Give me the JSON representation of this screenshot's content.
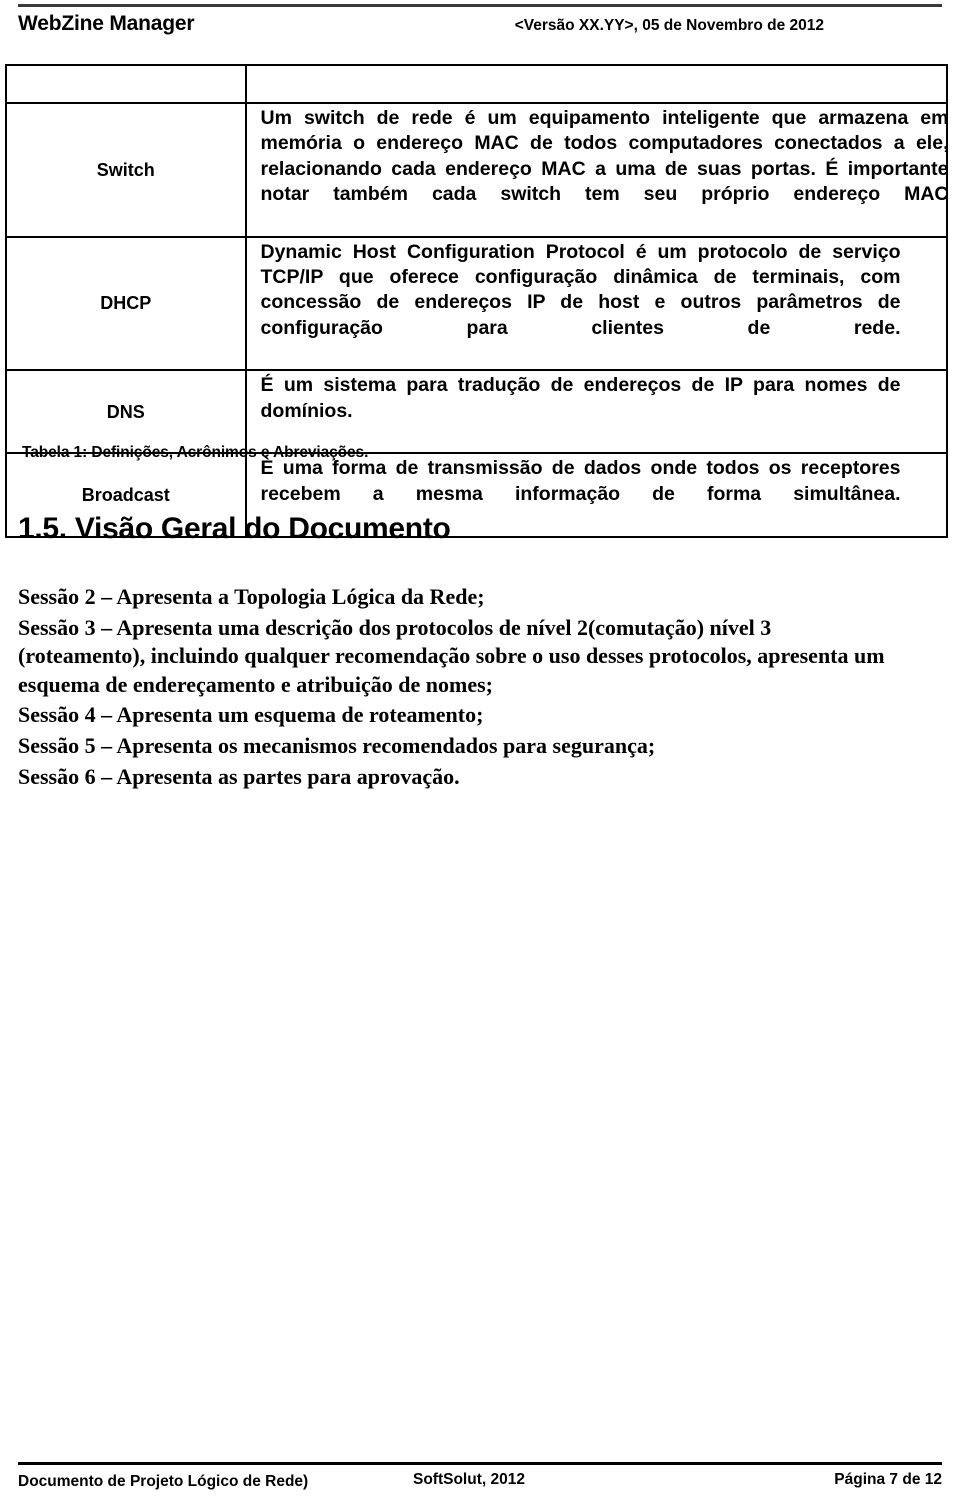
{
  "header": {
    "title": "WebZine Manager",
    "version": "<Versão XX.YY>, 05 de Novembro de 2012"
  },
  "table": {
    "caption": "Tabela 1: Definições, Acrônimos e Abreviações.",
    "header_row": {
      "term": "",
      "definition": ""
    },
    "rows": [
      {
        "term": "Switch",
        "definition": "Um switch de rede é um equipamento inteligente que armazena em memória o endereço MAC de todos computadores conectados a ele, relacionando cada endereço MAC a uma de suas portas. É importante notar também  cada switch tem  seu próprio endereço MAC"
      },
      {
        "term": "DHCP",
        "definition": "Dynamic Host Configuration Protocol é um protocolo de serviço TCP/IP que oferece configuração dinâmica de terminais, com concessão de endereços IP de host e outros parâmetros de configuração para clientes de rede."
      },
      {
        "term": "DNS",
        "definition": "É um sistema para tradução de endereços de IP para nomes de domínios."
      },
      {
        "term": "Broadcast",
        "definition": "È uma forma de transmissão de dados onde todos os receptores recebem a mesma informação de forma simultânea."
      }
    ]
  },
  "section": {
    "heading": "1.5.  Visão Geral do Documento",
    "paragraphs": [
      "Sessão  2  –  Apresenta a Topologia Lógica da Rede;",
      "Sessão 3 – Apresenta uma descrição dos protocolos de nível 2(comutação) nível 3 (roteamento), incluindo qualquer recomendação sobre o uso desses protocolos, apresenta um esquema de endereçamento e atribuição de nomes;",
      "Sessão  4  –  Apresenta um esquema de roteamento;",
      "Sessão  5  –  Apresenta os mecanismos recomendados para segurança;",
      "Sessão  6  –  Apresenta as partes para aprovação."
    ]
  },
  "footer": {
    "left": "Documento de Projeto Lógico de Rede)",
    "center": "SoftSolut, 2012",
    "right": "Página 7 de 12"
  }
}
